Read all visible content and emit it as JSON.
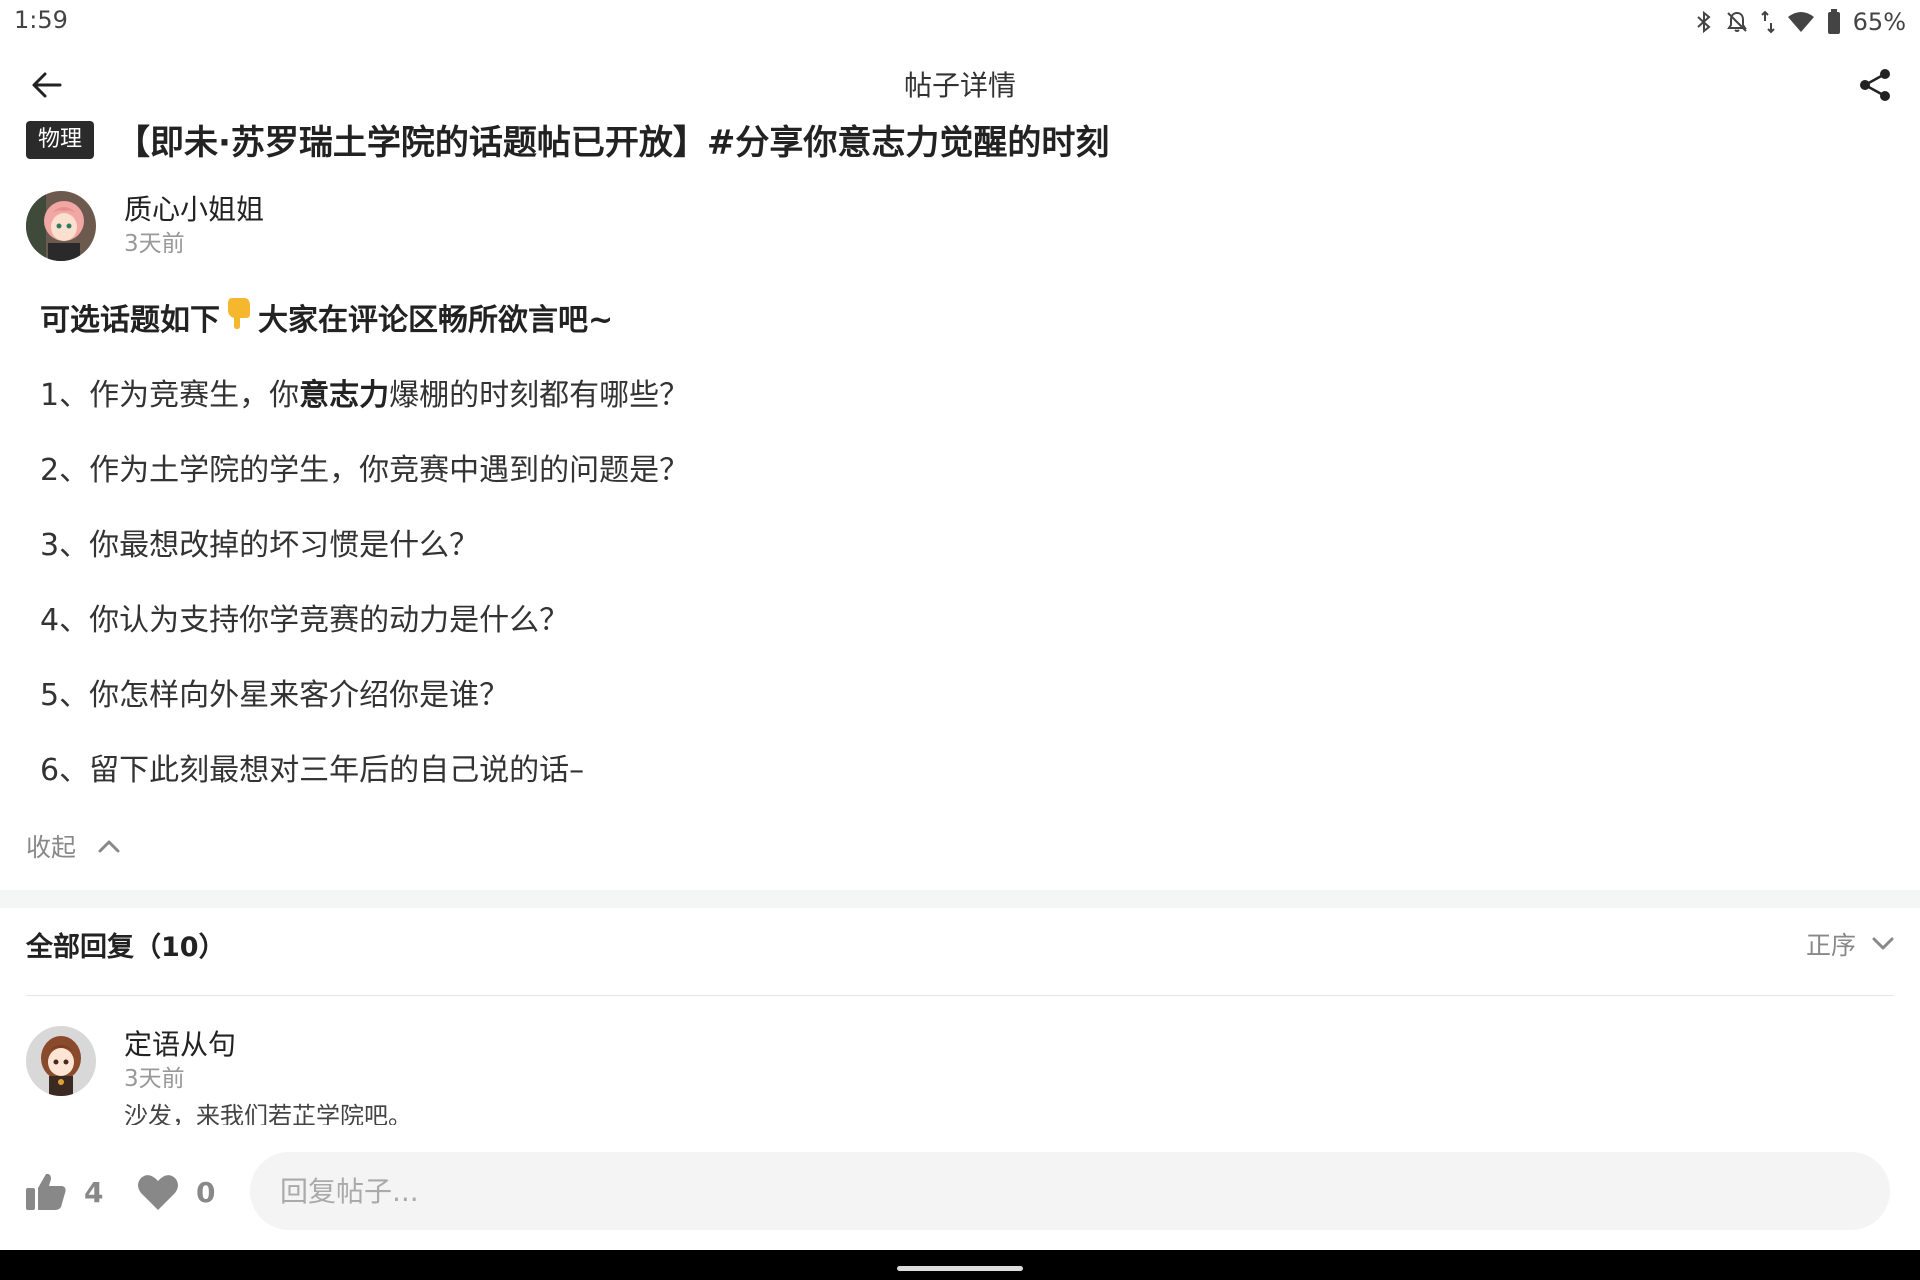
{
  "status_bar": {
    "time": "1:59",
    "battery": "65%",
    "icons": [
      "bluetooth-icon",
      "notifications-off-icon",
      "data-arrows-icon",
      "wifi-icon",
      "battery-icon"
    ]
  },
  "app_bar": {
    "title": "帖子详情",
    "back_icon": "arrow-left-icon",
    "share_icon": "share-icon"
  },
  "post": {
    "tag": "物理",
    "title": "【即未·苏罗瑞土学院的话题帖已开放】#分享你意志力觉醒的时刻",
    "author": {
      "name": "质心小姐姐",
      "time": "3天前"
    },
    "intro_before": "可选话题如下",
    "intro_emoji": "👇",
    "intro_after": "大家在评论区畅所欲言吧~",
    "questions": [
      {
        "before": "1、作为竞赛生，你",
        "bold": "意志力",
        "after": "爆棚的时刻都有哪些？"
      },
      {
        "before": "2、作为土学院的学生，你竞赛中遇到的问题是？",
        "bold": "",
        "after": ""
      },
      {
        "before": "3、你最想改掉的坏习惯是什么？",
        "bold": "",
        "after": ""
      },
      {
        "before": "4、你认为支持你学竞赛的动力是什么？",
        "bold": "",
        "after": ""
      },
      {
        "before": "5、你怎样向外星来客介绍你是谁？",
        "bold": "",
        "after": ""
      },
      {
        "before": "6、留下此刻最想对三年后的自己说的话–",
        "bold": "",
        "after": ""
      }
    ],
    "collapse_label": "收起"
  },
  "replies": {
    "title": "全部回复（10）",
    "sort_label": "正序",
    "items": [
      {
        "name": "定语从句",
        "time": "3天前",
        "text": "沙发，来我们若芷学院吧。"
      }
    ]
  },
  "bottom_bar": {
    "like_count": "4",
    "favorite_count": "0",
    "reply_placeholder": "回复帖子..."
  },
  "colors": {
    "tag_bg": "#2b2b2b",
    "muted_text": "#888888",
    "divider": "#f4f5f5",
    "input_bg": "#f4f4f4"
  }
}
